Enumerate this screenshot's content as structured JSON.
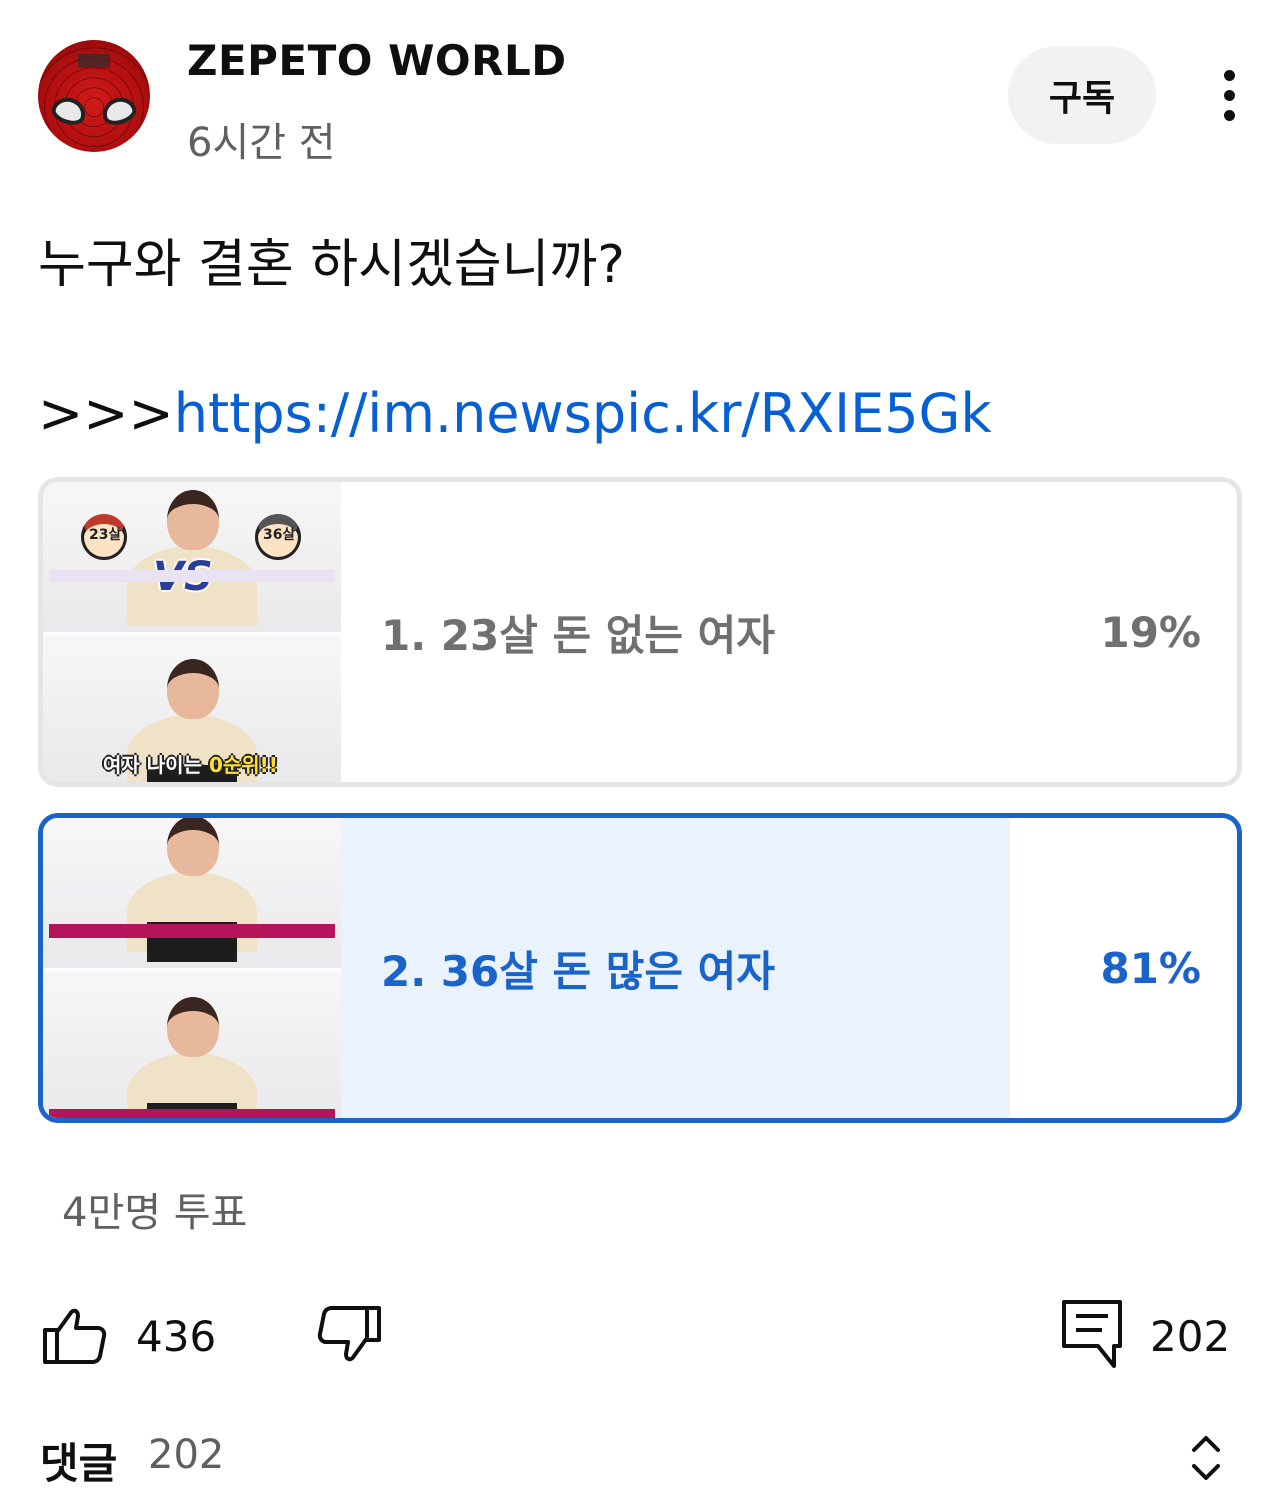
{
  "header": {
    "channel_name": "ZEPETO WORLD",
    "post_time": "6시간 전",
    "subscribe_label": "구독"
  },
  "post": {
    "question": "누구와 결혼 하시겠습니까?",
    "link_prefix": ">>>",
    "link_url": "https://im.newspic.kr/RXIE5Gk"
  },
  "poll": {
    "options": [
      {
        "label": "1. 23살 돈 없는 여자",
        "percent": "19%",
        "fraction": 0.19,
        "selected": false,
        "thumb_caption_a": "여자 나이는 ",
        "thumb_caption_hl": "0순위!!",
        "thumb_vs": "VS",
        "thumb_age_a": "23살",
        "thumb_age_b": "36살"
      },
      {
        "label": "2. 36살 돈 많은 여자",
        "percent": "81%",
        "fraction": 0.81,
        "selected": true
      }
    ],
    "vote_count": "4만명 투표"
  },
  "actions": {
    "like_count": "436",
    "comment_count": "202"
  },
  "comments": {
    "title": "댓글",
    "count": "202"
  },
  "colors": {
    "accent": "#1a64c9",
    "link": "#065fd4",
    "muted": "#606060",
    "unselected_fill": "#e6e6e6",
    "selected_fill": "#eaf3fd"
  },
  "icons": {
    "like": "thumbs-up-icon",
    "dislike": "thumbs-down-icon",
    "comment": "comment-icon",
    "more": "more-vertical-icon",
    "expand": "unfold-icon"
  }
}
